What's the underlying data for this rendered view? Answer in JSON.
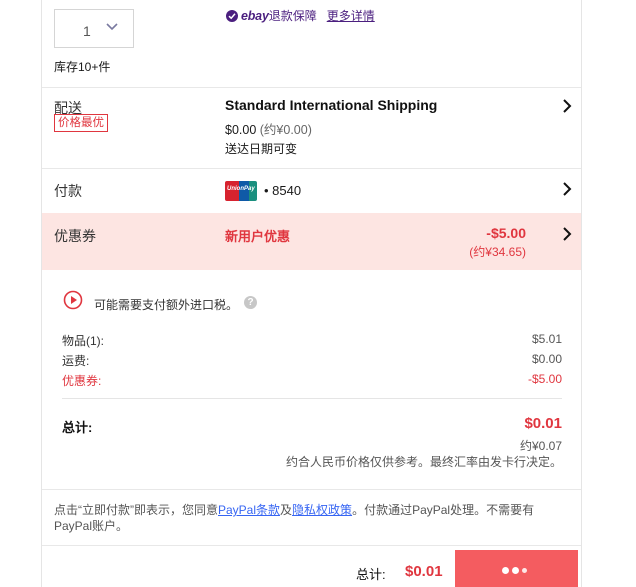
{
  "quantity": {
    "value": "1"
  },
  "stock": "库存10+件",
  "guarantee": {
    "brand": "ebay",
    "label": "退款保障",
    "link": "更多详情"
  },
  "shipping": {
    "label": "配送",
    "badge": "价格最优",
    "method": "Standard International Shipping",
    "price": "$0.00",
    "price_approx": "(约¥0.00)",
    "delivery": "送达日期可变"
  },
  "payment": {
    "label": "付款",
    "card_brand": "UnionPay",
    "card_number": "• 8540"
  },
  "coupon": {
    "label": "优惠券",
    "name": "新用户优惠",
    "amount": "-$5.00",
    "amount_approx": "(约¥34.65)"
  },
  "summary": {
    "duty_note": "可能需要支付额外进口税。",
    "items_label": "物品(1):",
    "items_value": "$5.01",
    "shipping_label": "运费:",
    "shipping_value": "$0.00",
    "coupon_label": "优惠券:",
    "coupon_value": "-$5.00",
    "total_label": "总计:",
    "total_value": "$0.01",
    "total_approx": "约¥0.07",
    "rate_note": "约合人民币价格仅供参考。最终汇率由发卡行决定。"
  },
  "terms": {
    "prefix": "点击“立即付款”即表示，您同意",
    "link1": "PayPal条款",
    "mid": "及",
    "link2": "隐私权政策",
    "suffix": "。付款通过PayPal处理。不需要有PayPal账户。"
  },
  "footer": {
    "total_label": "总计:",
    "total_value": "$0.01"
  },
  "colors": {
    "accent_red": "#e0363f",
    "pay_button": "#f45c60",
    "coupon_band": "#fde5e2",
    "link_blue": "#3665f3",
    "ebay_purple": "#4b1f7f"
  }
}
